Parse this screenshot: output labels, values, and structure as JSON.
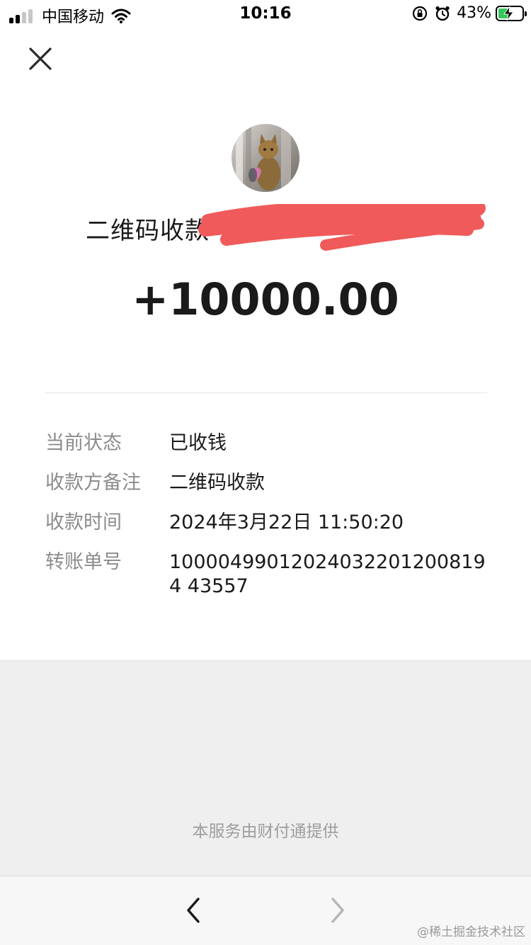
{
  "status_bar": {
    "carrier": "中国移动",
    "time": "10:16",
    "battery_percent": "43%",
    "battery_level": 0.43,
    "signal_bars_filled": 2,
    "signal_bars_total": 4,
    "icons": [
      "signal-icon",
      "wifi-icon",
      "orientation-lock-icon",
      "alarm-icon",
      "battery-icon",
      "charging-icon"
    ]
  },
  "header": {
    "close_icon": "close-icon",
    "avatar": "cat-avatar"
  },
  "transaction": {
    "title": "二维码收款-",
    "amount": "+10000.00",
    "redaction_color": "#f05a5a"
  },
  "details": [
    {
      "label": "当前状态",
      "value": "已收钱"
    },
    {
      "label": "收款方备注",
      "value": "二维码收款"
    },
    {
      "label": "收款时间",
      "value": "2024年3月22日 11:50:20"
    },
    {
      "label": "转账单号",
      "value": "100004990120240322012008194 43557"
    }
  ],
  "footer": {
    "provider_text": "本服务由财付通提供"
  },
  "bottom_nav": {
    "back_icon": "chevron-left-icon",
    "forward_icon": "chevron-right-icon"
  },
  "watermark": "@稀土掘金技术社区",
  "colors": {
    "battery_fill": "#34c759",
    "label_gray": "#8c8c8c",
    "footer_bg": "#efefef"
  }
}
